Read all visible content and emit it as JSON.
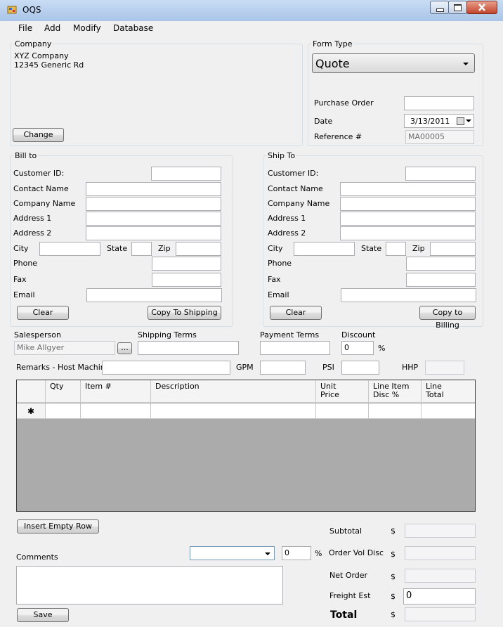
{
  "window": {
    "title": "OQS"
  },
  "menu": [
    "File",
    "Add",
    "Modify",
    "Database"
  ],
  "company": {
    "legend": "Company",
    "line1": "XYZ Company",
    "line2": "12345 Generic Rd",
    "change_label": "Change"
  },
  "form_type": {
    "legend": "Form Type",
    "selected": "Quote",
    "po_label": "Purchase Order",
    "date_label": "Date",
    "date_value": "3/13/2011",
    "ref_label": "Reference #",
    "ref_value": "MA00005"
  },
  "bill_to": {
    "legend": "Bill to",
    "customer_id": "Customer ID:",
    "contact_name": "Contact Name",
    "company_name": "Company Name",
    "address1": "Address 1",
    "address2": "Address 2",
    "city": "City",
    "state": "State",
    "zip": "Zip",
    "phone": "Phone",
    "fax": "Fax",
    "email": "Email",
    "clear_label": "Clear",
    "copy_label": "Copy To Shipping"
  },
  "ship_to": {
    "legend": "Ship To",
    "customer_id": "Customer ID:",
    "contact_name": "Contact Name",
    "company_name": "Company Name",
    "address1": "Address 1",
    "address2": "Address 2",
    "city": "City",
    "state": "State",
    "zip": "Zip",
    "phone": "Phone",
    "fax": "Fax",
    "email": "Email",
    "clear_label": "Clear",
    "copy_label": "Copy to Billing"
  },
  "order": {
    "salesperson_label": "Salesperson",
    "salesperson_value": "Mike Allgyer",
    "browse_label": "...",
    "shipping_terms_label": "Shipping Terms",
    "payment_terms_label": "Payment Terms",
    "discount_label": "Discount",
    "discount_value": "0",
    "percent": "%",
    "remarks_label": "Remarks - Host Machine",
    "gpm_label": "GPM",
    "psi_label": "PSI",
    "hhp_label": "HHP"
  },
  "grid": {
    "new_row_glyph": "✱",
    "headers": [
      {
        "line1": "Qty",
        "line2": ""
      },
      {
        "line1": "Item #",
        "line2": ""
      },
      {
        "line1": "Description",
        "line2": ""
      },
      {
        "line1": "Unit",
        "line2": "Price"
      },
      {
        "line1": "Line Item",
        "line2": "Disc %"
      },
      {
        "line1": "Line",
        "line2": "Total"
      }
    ]
  },
  "footer": {
    "insert_row_label": "Insert Empty Row",
    "comments_label": "Comments",
    "comment_pct_value": "0",
    "percent": "%",
    "save_label": "Save"
  },
  "totals": {
    "currency": "$",
    "subtotal_label": "Subtotal",
    "vol_disc_label": "Order Vol Disc",
    "net_order_label": "Net  Order",
    "freight_label": "Freight Est",
    "freight_value": "0",
    "total_label": "Total"
  }
}
